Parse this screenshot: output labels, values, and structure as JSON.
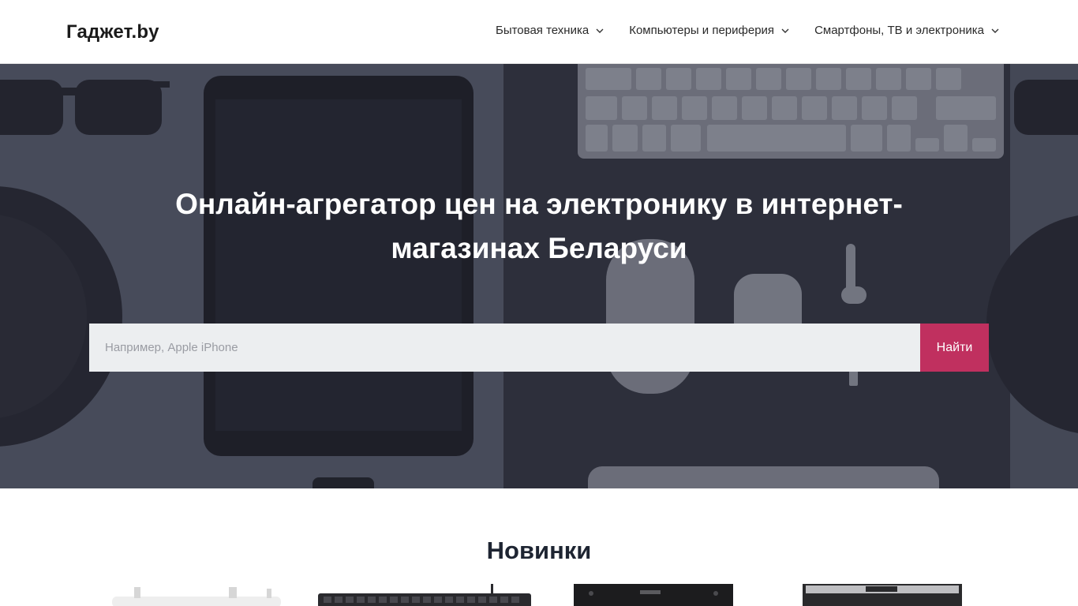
{
  "header": {
    "logo": "Гаджет.by",
    "nav": [
      {
        "label": "Бытовая техника"
      },
      {
        "label": "Компьютеры и периферия"
      },
      {
        "label": "Смартфоны, ТВ и электроника"
      }
    ]
  },
  "hero": {
    "title": "Онлайн-агрегатор цен на электронику в интернет-магазинах Беларуси",
    "search": {
      "placeholder": "Например, Apple iPhone",
      "value": "",
      "button_label": "Найти"
    }
  },
  "section": {
    "title": "Новинки"
  },
  "colors": {
    "accent": "#c0305f",
    "hero_overlay": "#3e4150",
    "title_dark": "#1e2532"
  },
  "icons": {
    "nav_chevron": "chevron-down-icon"
  }
}
